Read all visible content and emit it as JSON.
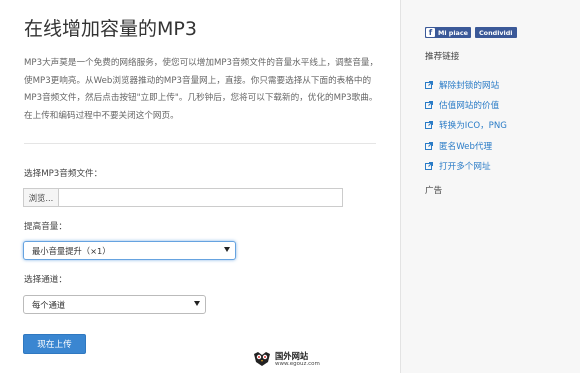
{
  "page": {
    "title": "在线增加容量的MP3",
    "description_lines": [
      "MP3大声莫是一个免费的网络服务，使您可以增加MP3音频文件的音量水平线上，调整音量，",
      "使MP3更响亮。从Web浏览器推动的MP3音量网上，直接。你只需要选择从下面的表格中的",
      "MP3音频文件，然后点击按钮\"立即上传\"。几秒钟后，您将可以下载新的，优化的MP3歌曲。",
      "在上传和编码过程中不要关闭这个网页。"
    ]
  },
  "form": {
    "file_label": "选择MP3音频文件：",
    "browse_label": "浏览...",
    "volume_label": "提高音量：",
    "volume_selected": "最小音量提升（×1）",
    "channel_label": "选择通道：",
    "channel_selected": "每个通道",
    "upload_label": "现在上传"
  },
  "watermark": {
    "site_name": "国外网站",
    "url": "www.egouz.com"
  },
  "sidebar": {
    "share": {
      "like_label": "Mi piace",
      "share_label": "Condividi",
      "facebook_color": "#3b5998"
    },
    "links_heading": "推荐链接",
    "links": [
      {
        "label": "解除封锁的网站",
        "icon": "external-link-icon"
      },
      {
        "label": "估值网站的价值",
        "icon": "external-link-icon"
      },
      {
        "label": "转换为ICO，PNG",
        "icon": "external-link-icon"
      },
      {
        "label": "匿名Web代理",
        "icon": "external-link-icon"
      },
      {
        "label": "打开多个网址",
        "icon": "external-link-icon"
      }
    ],
    "ads_heading": "广告"
  },
  "colors": {
    "accent": "#3a86d1",
    "link": "#2b7cc7",
    "sidebar_bg": "#f7f7f7"
  }
}
